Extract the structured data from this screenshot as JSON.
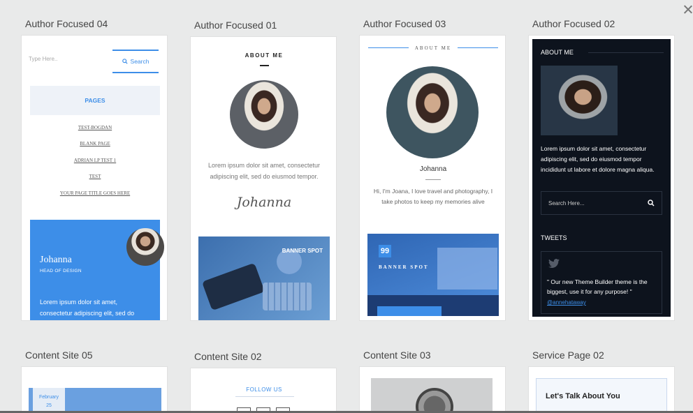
{
  "close_icon": "close-icon",
  "templates": [
    {
      "label": "Author Focused 04",
      "search_placeholder": "Type Here..",
      "search_label": "Search",
      "pages_title": "PAGES",
      "page_links": [
        "TEST-BOGDAN",
        "BLANK PAGE",
        "ADRIAN LP TEST 1",
        "TEST",
        "YOUR PAGE TITLE GOES HERE"
      ],
      "author_name": "Johanna",
      "author_role": "HEAD OF DESIGN",
      "author_text": "Lorem ipsum dolor sit amet, consectetur adipiscing elit, sed do"
    },
    {
      "label": "Author Focused 01",
      "about_title": "ABOUT ME",
      "about_text": "Lorem ipsum dolor sit amet, consectetur adipiscing elit, sed do eiusmod tempor.",
      "signature": "Johanna",
      "banner_text": "BANNER SPOT"
    },
    {
      "label": "Author Focused 03",
      "about_title": "ABOUT ME",
      "name": "Johanna",
      "bio": "Hi, I'm Joana, I love travel and photography, I take photos to keep my memories alive",
      "quote_mark": "99",
      "banner_text": "BANNER SPOT"
    },
    {
      "label": "Author Focused 02",
      "about_title": "ABOUT ME",
      "about_text": "Lorem ipsum dolor sit amet, consectetur adipiscing elit, sed do eiusmod tempor incididunt ut labore et dolore magna aliqua.",
      "search_placeholder": "Search Here...",
      "tweets_title": "TWEETS",
      "tweet_text": "\" Our new Theme Builder theme is the biggest, use it for any purpose! \"",
      "tweet_link": "@annehataway"
    },
    {
      "label": "Content Site 05",
      "date_month": "February",
      "date_day": "25"
    },
    {
      "label": "Content Site 02",
      "follow_text": "FOLLOW US"
    },
    {
      "label": "Content Site 03"
    },
    {
      "label": "Service Page 02",
      "heading": "Let's Talk About You"
    }
  ]
}
